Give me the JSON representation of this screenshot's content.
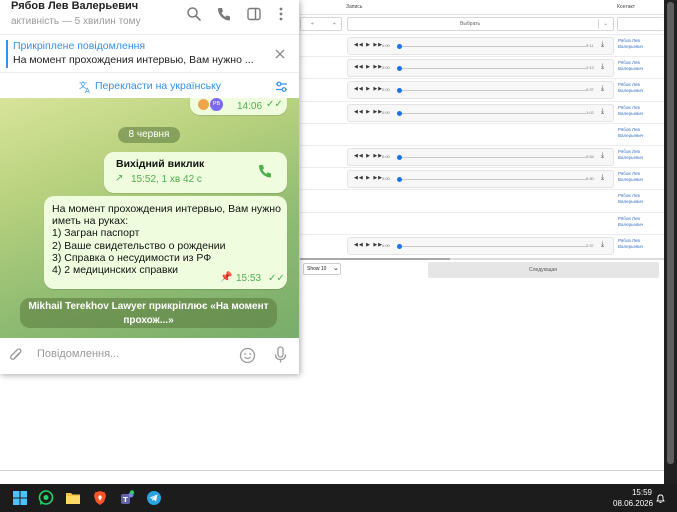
{
  "app": {
    "columns": {
      "record": "Запись",
      "contact": "Контакт"
    },
    "filter_select": "Выбрать",
    "rows": [
      {
        "duration": "9:11",
        "contact": "Рябов Лев Валерьевич",
        "has_audio": true
      },
      {
        "duration": "2:13",
        "contact": "Рябов Лев Валерьевич",
        "has_audio": true
      },
      {
        "duration": "0:37",
        "contact": "Рябов Лев Валерьевич",
        "has_audio": true
      },
      {
        "duration": "1:02",
        "contact": "Рябов Лев Валерьевич",
        "has_audio": true
      },
      {
        "duration": "",
        "contact": "Рябов Лев Валерьевич",
        "has_audio": false
      },
      {
        "duration": "0:54",
        "contact": "Рябов Лев Валерьевич",
        "has_audio": true
      },
      {
        "duration": "0:30",
        "contact": "Рябов Лев Валерьевич",
        "has_audio": true
      },
      {
        "duration": "",
        "contact": "Рябов Лев Валерьевич",
        "has_audio": false
      },
      {
        "duration": "",
        "contact": "Рябов Лев Валерьевич",
        "has_audio": false
      },
      {
        "duration": "2:37",
        "contact": "Рябов Лев Валерьевич",
        "has_audio": true
      }
    ],
    "player": {
      "start_time": "0:00"
    },
    "pagination": {
      "show_label": "Show 10",
      "next_label": "Следующая"
    }
  },
  "telegram": {
    "contact_name": "Рябов Лев Валерьевич",
    "status": "активність — 5 хвилин тому",
    "pinned": {
      "title": "Прикріплене повідомлення",
      "text": "На момент прохождения интервью, Вам нужно ..."
    },
    "translate_label": "Перекласти на українську",
    "prev_message_time": "14:06",
    "prev_avatar_initials": "РВ",
    "date_divider": "8 червня",
    "call": {
      "title": "Вихідний виклик",
      "details": "15:52, 1 хв 42 с"
    },
    "message": {
      "lines": [
        "На момент прохождения интервью, Вам нужно",
        "иметь на руках:",
        "1) Загран паспорт",
        "2) Ваше свидетельство о рождении",
        "3) Справка о несудимости из РФ",
        "4) 2 медицинских справки"
      ],
      "time": "15:53"
    },
    "service_message": "Mikhail Terekhov Lawyer прикріплює «На момент прохож...»",
    "composer_placeholder": "Повідомлення..."
  },
  "taskbar": {
    "time": "15:59",
    "date": "08.06.2026",
    "apps": [
      "windows-start",
      "whatsapp",
      "file-explorer",
      "brave-browser",
      "teams",
      "telegram"
    ]
  },
  "colors": {
    "telegram_blue": "#3390ec",
    "telegram_green": "#4fae4e",
    "outgoing_bubble": "#effdde",
    "taskbar": "#1c1c1c"
  }
}
